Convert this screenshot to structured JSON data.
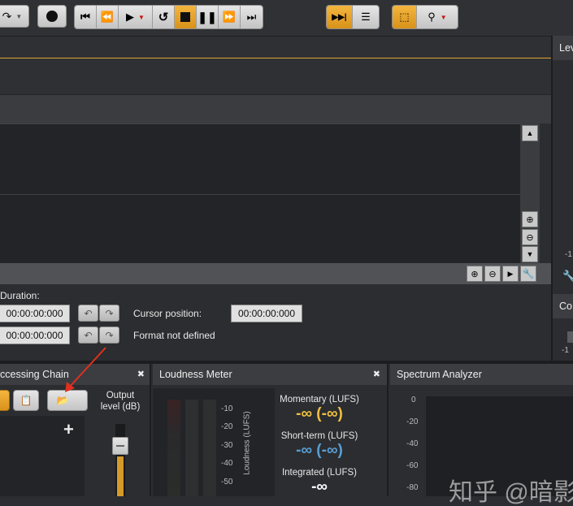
{
  "top_right_panel": {
    "title": "Lev",
    "label_tick": "-1"
  },
  "right_panel_2": {
    "title": "Co",
    "tick": "-1"
  },
  "info": {
    "duration_label": "Duration:",
    "duration_value": "00:00:00:000",
    "selection_value": "00:00:00:000",
    "cursor_label": "Cursor position:",
    "cursor_value": "00:00:00:000",
    "format_text": "Format not defined"
  },
  "processing_chain": {
    "title": "ccessing Chain",
    "output_label_1": "Output",
    "output_label_2": "level (dB)",
    "close_glyph": "✖",
    "add_glyph": "+"
  },
  "loudness": {
    "title": "Loudness Meter",
    "close_glyph": "✖",
    "ticks": [
      "-10",
      "-20",
      "-30",
      "-40",
      "-50"
    ],
    "axis_label": "Loudness (LUFS)",
    "momentary_label": "Momentary (LUFS)",
    "momentary_value": "-∞ (-∞)",
    "shortterm_label": "Short-term (LUFS)",
    "shortterm_value": "-∞ (-∞)",
    "integrated_label": "Integrated (LUFS)",
    "integrated_value": "-∞",
    "colors": {
      "momentary": "#f0c040",
      "shortterm": "#5a9fd6",
      "integrated": "#ffffff"
    }
  },
  "spectrum": {
    "title": "Spectrum Analyzer",
    "ticks": [
      "0",
      "-20",
      "-40",
      "-60",
      "-80"
    ]
  },
  "watermark": "知乎 @暗影"
}
